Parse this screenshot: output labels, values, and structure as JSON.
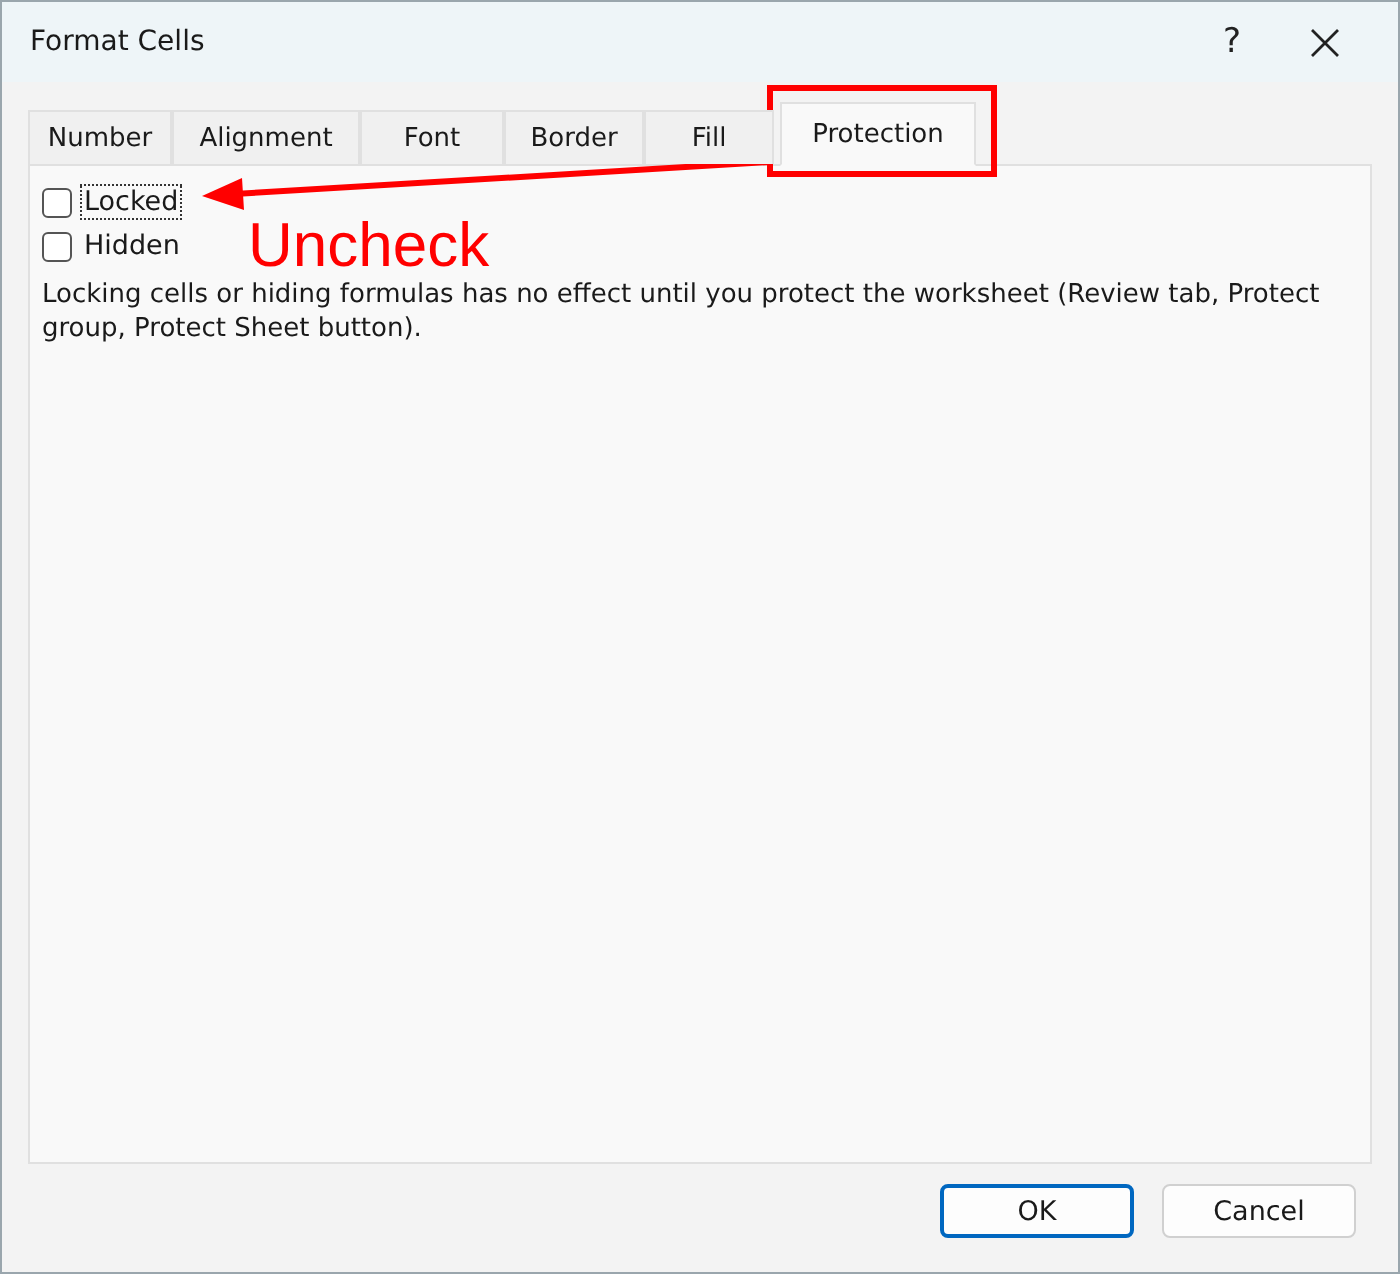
{
  "window": {
    "title": "Format Cells",
    "help": "?"
  },
  "tabs": [
    {
      "label": "Number",
      "selected": false
    },
    {
      "label": "Alignment",
      "selected": false
    },
    {
      "label": "Font",
      "selected": false
    },
    {
      "label": "Border",
      "selected": false
    },
    {
      "label": "Fill",
      "selected": false
    },
    {
      "label": "Protection",
      "selected": true
    }
  ],
  "options": [
    {
      "label": "Locked",
      "checked": false,
      "focused": true
    },
    {
      "label": "Hidden",
      "checked": false,
      "focused": false
    }
  ],
  "note": "Locking cells or hiding formulas has no effect until you protect the worksheet (Review tab, Protect group, Protect Sheet button).",
  "annotation": {
    "text": "Uncheck"
  },
  "buttons": [
    {
      "label": "OK",
      "default": true
    },
    {
      "label": "Cancel",
      "default": false
    }
  ]
}
